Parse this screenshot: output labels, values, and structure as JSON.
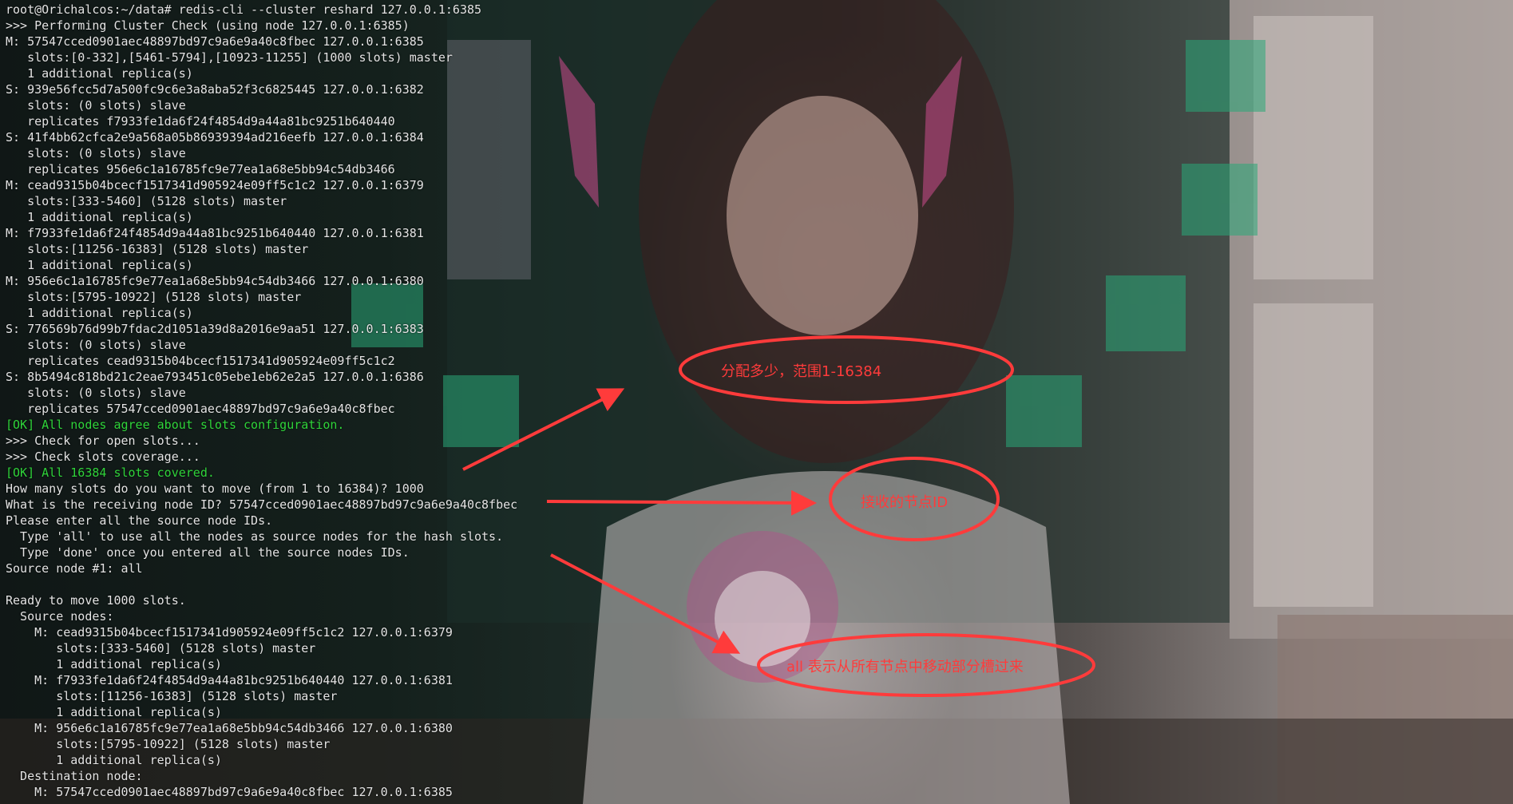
{
  "terminal": {
    "lines": [
      {
        "text": "root@Orichalcos:~/data# redis-cli --cluster reshard 127.0.0.1:6385",
        "style": "normal"
      },
      {
        "text": ">>> Performing Cluster Check (using node 127.0.0.1:6385)",
        "style": "normal"
      },
      {
        "text": "M: 57547cced0901aec48897bd97c9a6e9a40c8fbec 127.0.0.1:6385",
        "style": "normal"
      },
      {
        "text": "   slots:[0-332],[5461-5794],[10923-11255] (1000 slots) master",
        "style": "normal"
      },
      {
        "text": "   1 additional replica(s)",
        "style": "normal"
      },
      {
        "text": "S: 939e56fcc5d7a500fc9c6e3a8aba52f3c6825445 127.0.0.1:6382",
        "style": "normal"
      },
      {
        "text": "   slots: (0 slots) slave",
        "style": "normal"
      },
      {
        "text": "   replicates f7933fe1da6f24f4854d9a44a81bc9251b640440",
        "style": "normal"
      },
      {
        "text": "S: 41f4bb62cfca2e9a568a05b86939394ad216eefb 127.0.0.1:6384",
        "style": "normal"
      },
      {
        "text": "   slots: (0 slots) slave",
        "style": "normal"
      },
      {
        "text": "   replicates 956e6c1a16785fc9e77ea1a68e5bb94c54db3466",
        "style": "normal"
      },
      {
        "text": "M: cead9315b04bcecf1517341d905924e09ff5c1c2 127.0.0.1:6379",
        "style": "normal"
      },
      {
        "text": "   slots:[333-5460] (5128 slots) master",
        "style": "normal"
      },
      {
        "text": "   1 additional replica(s)",
        "style": "normal"
      },
      {
        "text": "M: f7933fe1da6f24f4854d9a44a81bc9251b640440 127.0.0.1:6381",
        "style": "normal"
      },
      {
        "text": "   slots:[11256-16383] (5128 slots) master",
        "style": "normal"
      },
      {
        "text": "   1 additional replica(s)",
        "style": "normal"
      },
      {
        "text": "M: 956e6c1a16785fc9e77ea1a68e5bb94c54db3466 127.0.0.1:6380",
        "style": "normal"
      },
      {
        "text": "   slots:[5795-10922] (5128 slots) master",
        "style": "normal"
      },
      {
        "text": "   1 additional replica(s)",
        "style": "normal"
      },
      {
        "text": "S: 776569b76d99b7fdac2d1051a39d8a2016e9aa51 127.0.0.1:6383",
        "style": "normal"
      },
      {
        "text": "   slots: (0 slots) slave",
        "style": "normal"
      },
      {
        "text": "   replicates cead9315b04bcecf1517341d905924e09ff5c1c2",
        "style": "normal"
      },
      {
        "text": "S: 8b5494c818bd21c2eae793451c05ebe1eb62e2a5 127.0.0.1:6386",
        "style": "normal"
      },
      {
        "text": "   slots: (0 slots) slave",
        "style": "normal"
      },
      {
        "text": "   replicates 57547cced0901aec48897bd97c9a6e9a40c8fbec",
        "style": "normal"
      },
      {
        "text": "[OK] All nodes agree about slots configuration.",
        "style": "ok"
      },
      {
        "text": ">>> Check for open slots...",
        "style": "normal"
      },
      {
        "text": ">>> Check slots coverage...",
        "style": "normal"
      },
      {
        "text": "[OK] All 16384 slots covered.",
        "style": "ok"
      },
      {
        "text": "How many slots do you want to move (from 1 to 16384)? 1000",
        "style": "normal"
      },
      {
        "text": "What is the receiving node ID? 57547cced0901aec48897bd97c9a6e9a40c8fbec",
        "style": "normal"
      },
      {
        "text": "Please enter all the source node IDs.",
        "style": "normal"
      },
      {
        "text": "  Type 'all' to use all the nodes as source nodes for the hash slots.",
        "style": "normal"
      },
      {
        "text": "  Type 'done' once you entered all the source nodes IDs.",
        "style": "normal"
      },
      {
        "text": "Source node #1: all",
        "style": "normal"
      },
      {
        "text": "",
        "style": "normal"
      },
      {
        "text": "Ready to move 1000 slots.",
        "style": "normal"
      },
      {
        "text": "  Source nodes:",
        "style": "normal"
      },
      {
        "text": "    M: cead9315b04bcecf1517341d905924e09ff5c1c2 127.0.0.1:6379",
        "style": "normal"
      },
      {
        "text": "       slots:[333-5460] (5128 slots) master",
        "style": "normal"
      },
      {
        "text": "       1 additional replica(s)",
        "style": "normal"
      },
      {
        "text": "    M: f7933fe1da6f24f4854d9a44a81bc9251b640440 127.0.0.1:6381",
        "style": "normal"
      },
      {
        "text": "       slots:[11256-16383] (5128 slots) master",
        "style": "normal"
      },
      {
        "text": "       1 additional replica(s)",
        "style": "normal"
      },
      {
        "text": "    M: 956e6c1a16785fc9e77ea1a68e5bb94c54db3466 127.0.0.1:6380",
        "style": "normal"
      },
      {
        "text": "       slots:[5795-10922] (5128 slots) master",
        "style": "normal"
      },
      {
        "text": "       1 additional replica(s)",
        "style": "normal"
      },
      {
        "text": "  Destination node:",
        "style": "normal"
      },
      {
        "text": "    M: 57547cced0901aec48897bd97c9a6e9a40c8fbec 127.0.0.1:6385",
        "style": "normal"
      }
    ]
  },
  "annotations": {
    "color": "#ff3b3b",
    "slot_count": "分配多少，范围1-16384",
    "receiving_node": "接收的节点ID",
    "source_all": "all 表示从所有节点中移动部分槽过来"
  },
  "colors": {
    "ok_text": "#2fd43a",
    "terminal_text": "#e4e4e4"
  }
}
